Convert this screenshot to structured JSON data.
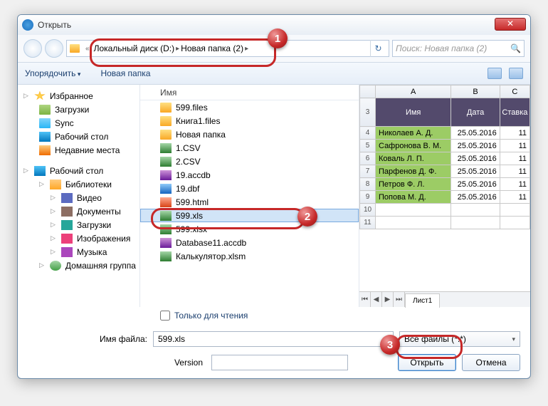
{
  "title": "Открыть",
  "breadcrumb": {
    "drive": "Локальный диск (D:)",
    "folder": "Новая папка (2)"
  },
  "search": {
    "placeholder": "Поиск: Новая папка (2)"
  },
  "toolbar": {
    "organize": "Упорядочить",
    "newfolder": "Новая папка"
  },
  "nav": {
    "favorites": "Избранное",
    "downloads": "Загрузки",
    "sync": "Sync",
    "desktop": "Рабочий стол",
    "recent": "Недавние места",
    "desktop2": "Рабочий стол",
    "libraries": "Библиотеки",
    "video": "Видео",
    "documents": "Документы",
    "downloads2": "Загрузки",
    "images": "Изображения",
    "music": "Музыка",
    "homegroup": "Домашняя группа"
  },
  "filehead": "Имя",
  "files": [
    {
      "n": "599.files",
      "t": "fold"
    },
    {
      "n": "Книга1.files",
      "t": "fold"
    },
    {
      "n": "Новая папка",
      "t": "fold"
    },
    {
      "n": "1.CSV",
      "t": "csv"
    },
    {
      "n": "2.CSV",
      "t": "csv"
    },
    {
      "n": "19.accdb",
      "t": "accdb"
    },
    {
      "n": "19.dbf",
      "t": "dbf"
    },
    {
      "n": "599.html",
      "t": "html"
    },
    {
      "n": "599.xls",
      "t": "xls"
    },
    {
      "n": "599.xlsx",
      "t": "xlsx"
    },
    {
      "n": "Database11.accdb",
      "t": "accdb"
    },
    {
      "n": "Калькулятор.xlsm",
      "t": "xlsm"
    }
  ],
  "selected_index": 8,
  "chart_data": {
    "type": "table",
    "columns": [
      "",
      "A",
      "B",
      "C"
    ],
    "header_row": [
      "",
      "Имя",
      "Дата",
      "Ставка"
    ],
    "header_row_index": 3,
    "rows": [
      {
        "i": 4,
        "a": "Николаев А. Д.",
        "b": "25.05.2016",
        "c": "11"
      },
      {
        "i": 5,
        "a": "Сафронова В. М.",
        "b": "25.05.2016",
        "c": "11"
      },
      {
        "i": 6,
        "a": "Коваль Л. П.",
        "b": "25.05.2016",
        "c": "11"
      },
      {
        "i": 7,
        "a": "Парфенов Д. Ф.",
        "b": "25.05.2016",
        "c": "11"
      },
      {
        "i": 8,
        "a": "Петров Ф. Л.",
        "b": "25.05.2016",
        "c": "11"
      },
      {
        "i": 9,
        "a": "Попова М. Д.",
        "b": "25.05.2016",
        "c": "11"
      }
    ],
    "empty_rows": [
      10,
      11
    ],
    "sheet_tab": "Лист1"
  },
  "readonly_label": "Только для чтения",
  "filename_label": "Имя файла:",
  "filename_value": "599.xls",
  "filter": "Все файлы (*.*)",
  "version_label": "Version",
  "open_btn": "Открыть",
  "cancel_btn": "Отмена"
}
